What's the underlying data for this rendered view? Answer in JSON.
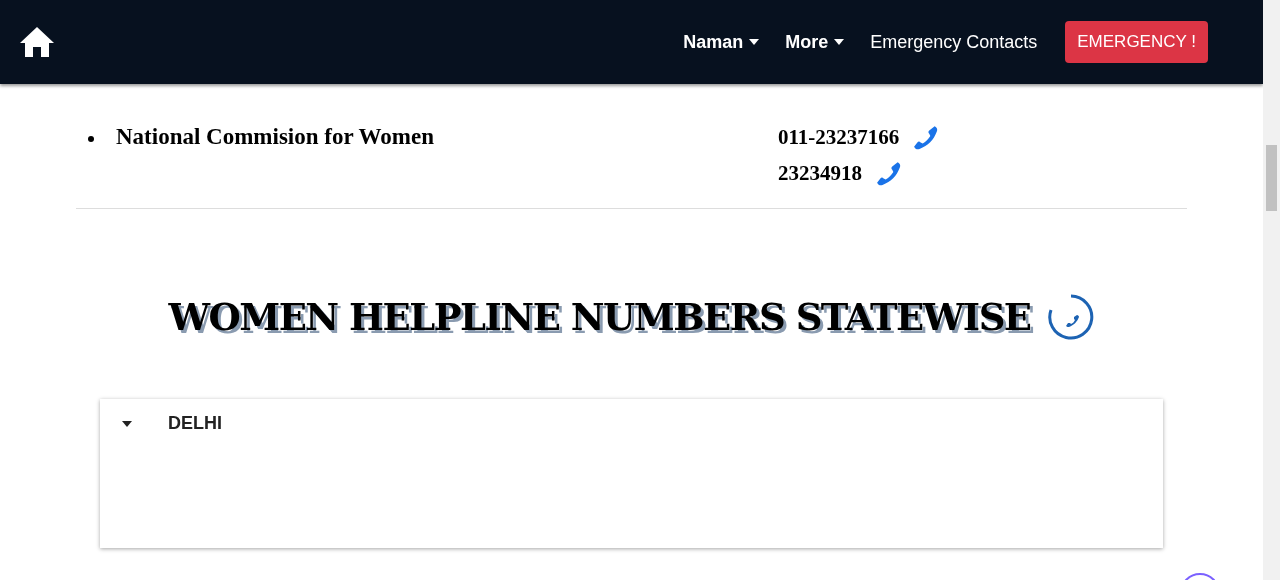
{
  "navbar": {
    "menus": [
      {
        "label": "Naman",
        "kind": "dropdown"
      },
      {
        "label": "More",
        "kind": "dropdown"
      },
      {
        "label": "Emergency Contacts",
        "kind": "link"
      }
    ],
    "emergency_button": "EMERGENCY !"
  },
  "helplines": [
    {
      "name": "National Commision for Women",
      "numbers": [
        "011-23237166",
        "23234918"
      ]
    }
  ],
  "section_title": "WOMEN HELPLINE NUMBERS STATEWISE",
  "states": [
    {
      "name": "DELHI",
      "expanded": true
    }
  ]
}
